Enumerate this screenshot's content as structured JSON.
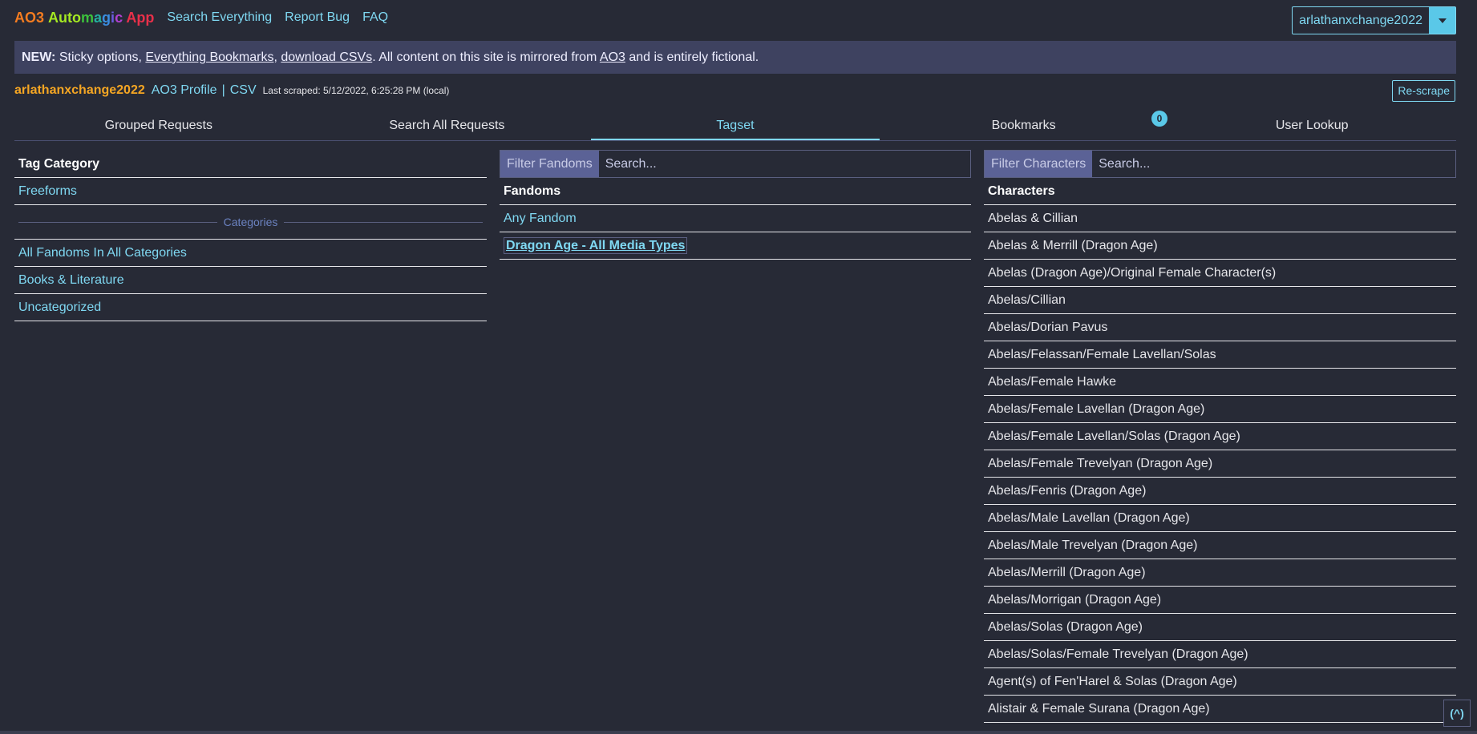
{
  "header": {
    "logo_parts": [
      {
        "text": "AO3",
        "color": "#f47c20"
      },
      {
        "text": " ",
        "color": "#ffffff"
      },
      {
        "text": "Auto",
        "color": "#a4e822"
      },
      {
        "text": "m",
        "color": "#3cc23c"
      },
      {
        "text": "a",
        "color": "#24b0a0"
      },
      {
        "text": "g",
        "color": "#3a8de0"
      },
      {
        "text": "i",
        "color": "#6a5ae0"
      },
      {
        "text": "c",
        "color": "#b040d0"
      },
      {
        "text": " App",
        "color": "#e8304a"
      }
    ],
    "nav": [
      "Search Everything",
      "Report Bug",
      "FAQ"
    ],
    "user_dropdown": "arlathanxchange2022"
  },
  "banner": {
    "new_label": "NEW:",
    "text1": " Sticky options, ",
    "link1": "Everything Bookmarks",
    "text2": ", ",
    "link2": "download CSVs",
    "text3": ". All content on this site is mirrored from ",
    "link3": "AO3",
    "text4": " and is entirely fictional."
  },
  "info": {
    "username": "arlathanxchange2022",
    "profile_link": "AO3 Profile",
    "separator": "|",
    "csv_link": "CSV",
    "last_scraped": "Last scraped: 5/12/2022, 6:25:28 PM (local)",
    "rescrape": "Re-scrape"
  },
  "tabs": [
    "Grouped Requests",
    "Search All Requests",
    "Tagset",
    "Bookmarks",
    "User Lookup"
  ],
  "active_tab": "Tagset",
  "bookmarks_badge": "0",
  "tag_category": {
    "heading": "Tag Category",
    "items_top": [
      "Freeforms"
    ],
    "divider_label": "Categories",
    "items": [
      "All Fandoms In All Categories",
      "Books & Literature",
      "Uncategorized"
    ]
  },
  "fandoms": {
    "filter_label": "Filter Fandoms",
    "placeholder": "Search...",
    "heading": "Fandoms",
    "items": [
      "Any Fandom"
    ],
    "selected": "Dragon Age - All Media Types"
  },
  "characters": {
    "filter_label": "Filter Characters",
    "placeholder": "Search...",
    "heading": "Characters",
    "items": [
      "Abelas & Cillian",
      "Abelas & Merrill (Dragon Age)",
      "Abelas (Dragon Age)/Original Female Character(s)",
      "Abelas/Cillian",
      "Abelas/Dorian Pavus",
      "Abelas/Felassan/Female Lavellan/Solas",
      "Abelas/Female Hawke",
      "Abelas/Female Lavellan (Dragon Age)",
      "Abelas/Female Lavellan/Solas (Dragon Age)",
      "Abelas/Female Trevelyan (Dragon Age)",
      "Abelas/Fenris (Dragon Age)",
      "Abelas/Male Lavellan (Dragon Age)",
      "Abelas/Male Trevelyan (Dragon Age)",
      "Abelas/Merrill (Dragon Age)",
      "Abelas/Morrigan (Dragon Age)",
      "Abelas/Solas (Dragon Age)",
      "Abelas/Solas/Female Trevelyan (Dragon Age)",
      "Agent(s) of Fen'Harel & Solas (Dragon Age)",
      "Alistair & Female Surana (Dragon Age)"
    ]
  },
  "scroll_top": "(^)",
  "colors": {
    "background": "#272a36",
    "accent": "#7fd8f2",
    "username": "#f5a623",
    "banner": "#3e4260"
  }
}
